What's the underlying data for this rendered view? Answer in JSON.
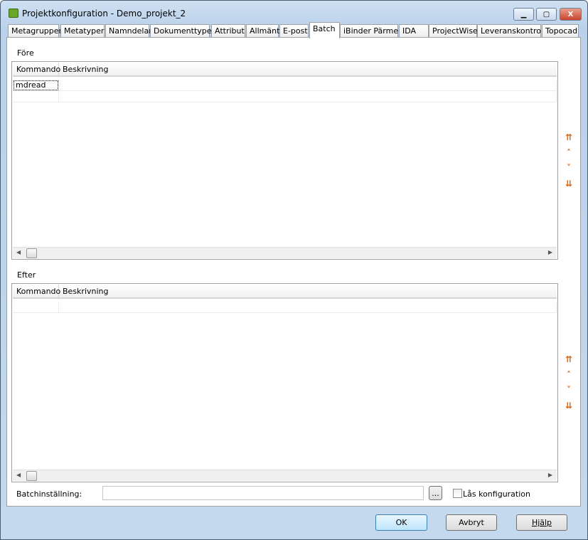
{
  "window": {
    "title": "Projektkonfiguration - Demo_projekt_2",
    "minimize": "▁",
    "maximize": "▢",
    "close": "X"
  },
  "tabs": [
    "Metagrupper",
    "Metatyper",
    "Namndelar",
    "Dokumenttyper",
    "Attribut",
    "Allmänt",
    "E-post",
    "Batch",
    "iBinder Pärmen",
    "IDA",
    "ProjectWise",
    "Leveranskontroll",
    "Topocad"
  ],
  "selected_tab": "Batch",
  "fore": {
    "label": "Före",
    "columns": [
      "Kommando",
      "Beskrivning"
    ],
    "rows": [
      [
        "mdread",
        ""
      ],
      [
        "",
        ""
      ]
    ]
  },
  "efter": {
    "label": "Efter",
    "columns": [
      "Kommando",
      "Beskrivning"
    ],
    "rows": [
      [
        "",
        ""
      ]
    ]
  },
  "arrows": {
    "top": "⇈",
    "up": "˄",
    "down": "˅",
    "bottom": "⇊"
  },
  "batch": {
    "label": "Batchinställning:",
    "value": "",
    "browse": "...",
    "lock_label": "Lås konfiguration",
    "lock_checked": false
  },
  "buttons": {
    "ok": "OK",
    "cancel": "Avbryt",
    "help": "Hjälp"
  }
}
